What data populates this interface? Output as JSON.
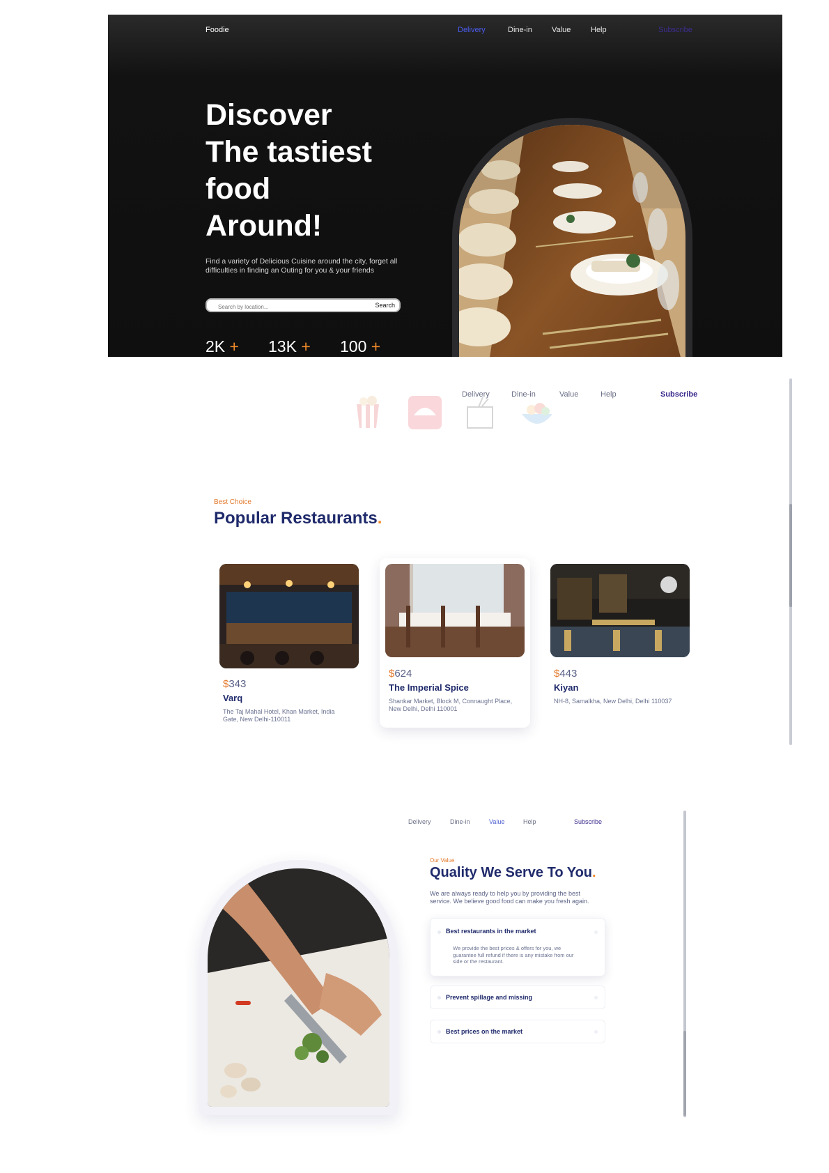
{
  "hero": {
    "logo": "Foodie",
    "nav": [
      "Delivery",
      "Dine-in",
      "Value",
      "Help"
    ],
    "active_nav": "Delivery",
    "subscribe": "Subscribe",
    "headline": [
      "Discover",
      "The tastiest",
      "food",
      "Around!"
    ],
    "description": "Find a variety of Delicious Cuisine around the city, forget all difficulties in finding an Outing for you & your friends",
    "search": {
      "placeholder": "Search by location...",
      "button": "Search"
    },
    "stats": [
      {
        "value": "2K",
        "suffix": "+"
      },
      {
        "value": "13K",
        "suffix": "+"
      },
      {
        "value": "100",
        "suffix": "+"
      }
    ],
    "image_icon": "restaurant-table-photo"
  },
  "section2": {
    "nav": [
      "Delivery",
      "Dine-in",
      "Value",
      "Help"
    ],
    "subscribe": "Subscribe",
    "brand_icons": [
      "kfc-logo-icon",
      "pizza-hut-logo-icon",
      "takeout-box-icon",
      "salad-bowl-icon"
    ],
    "kicker": "Best Choice",
    "title": "Popular Restaurants",
    "title_dot": ".",
    "restaurants": [
      {
        "currency": "$",
        "price": "343",
        "name": "Varq",
        "address": "The Taj Mahal Hotel, Khan Market, India Gate, New Delhi-110011"
      },
      {
        "currency": "$",
        "price": "624",
        "name": "The Imperial Spice",
        "address": "Shankar Market, Block M, Connaught Place, New Delhi, Delhi 110001"
      },
      {
        "currency": "$",
        "price": "443",
        "name": "Kiyan",
        "address": "NH-8, Samalkha, New Delhi, Delhi 110037"
      }
    ]
  },
  "section3": {
    "nav": [
      "Delivery",
      "Dine-in",
      "Value",
      "Help"
    ],
    "active_nav": "Value",
    "subscribe": "Subscribe",
    "kicker": "Our Value",
    "title": "Quality We Serve To You",
    "title_dot": ".",
    "description": "We are always ready to help you by providing the best service. We believe good food can make you fresh again.",
    "features": [
      {
        "title": "Best restaurants in the market",
        "body": "We provide the best prices & offers for you, we guarantee full refund if there is any mistake from our side or the restaurant.",
        "open": true
      },
      {
        "title": "Prevent spillage and missing",
        "body": "",
        "open": false
      },
      {
        "title": "Best prices on the market",
        "body": "",
        "open": false
      }
    ],
    "image_icon": "chef-chopping-photo"
  },
  "colors": {
    "accent": "#f08a2a",
    "navy": "#1f2a6b",
    "active_nav": "#4b5cf0",
    "subscribe": "#3b2a8c",
    "hero_bg": "#111111"
  }
}
